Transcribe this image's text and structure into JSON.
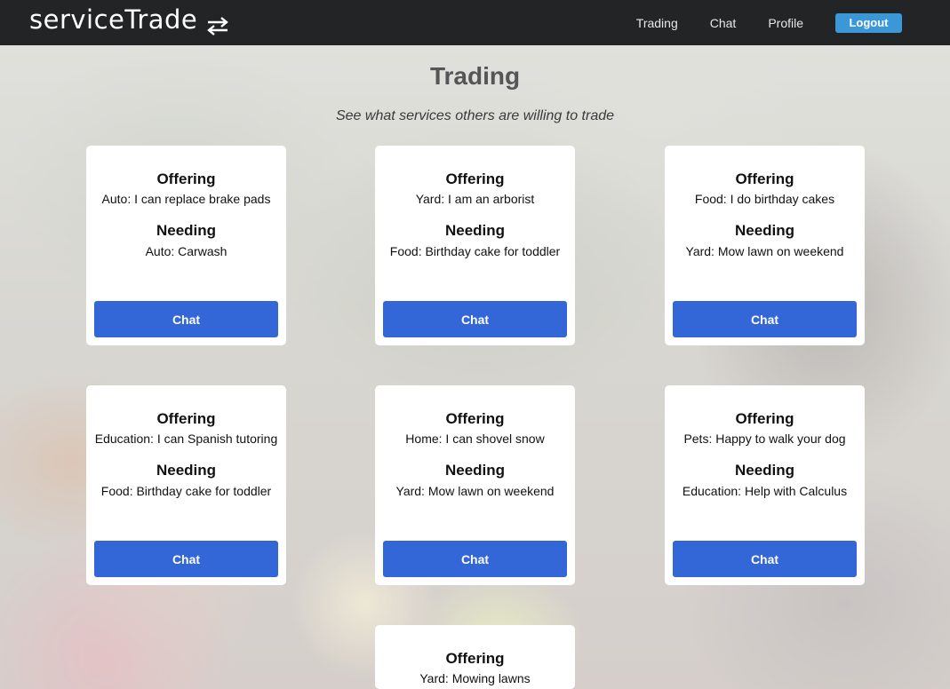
{
  "nav": {
    "brand": "serviceTrade",
    "brand_icon": "swap-arrows-icon",
    "links": [
      "Trading",
      "Chat",
      "Profile"
    ],
    "logout_label": "Logout"
  },
  "header": {
    "title": "Trading",
    "subtitle": "See what services others are willing to trade"
  },
  "cards": [
    {
      "offering_label": "Offering",
      "offering": "Auto: I can replace brake pads",
      "needing_label": "Needing",
      "needing": "Auto: Carwash",
      "chat_label": "Chat"
    },
    {
      "offering_label": "Offering",
      "offering": "Yard: I am an arborist",
      "needing_label": "Needing",
      "needing": "Food: Birthday cake for toddler",
      "chat_label": "Chat"
    },
    {
      "offering_label": "Offering",
      "offering": "Food: I do birthday cakes",
      "needing_label": "Needing",
      "needing": "Yard: Mow lawn on weekend",
      "chat_label": "Chat"
    },
    {
      "offering_label": "Offering",
      "offering": "Education: I can Spanish tutoring",
      "needing_label": "Needing",
      "needing": "Food: Birthday cake for toddler",
      "chat_label": "Chat"
    },
    {
      "offering_label": "Offering",
      "offering": "Home: I can shovel snow",
      "needing_label": "Needing",
      "needing": "Yard: Mow lawn on weekend",
      "chat_label": "Chat"
    },
    {
      "offering_label": "Offering",
      "offering": "Pets: Happy to walk your dog",
      "needing_label": "Needing",
      "needing": "Education: Help with Calculus",
      "chat_label": "Chat"
    },
    {
      "offering_label": "Offering",
      "offering": "Yard: Mowing lawns"
    }
  ],
  "colors": {
    "navbar": "#222426",
    "logout_button": "#3a98d8",
    "chat_button": "#3366d6"
  }
}
